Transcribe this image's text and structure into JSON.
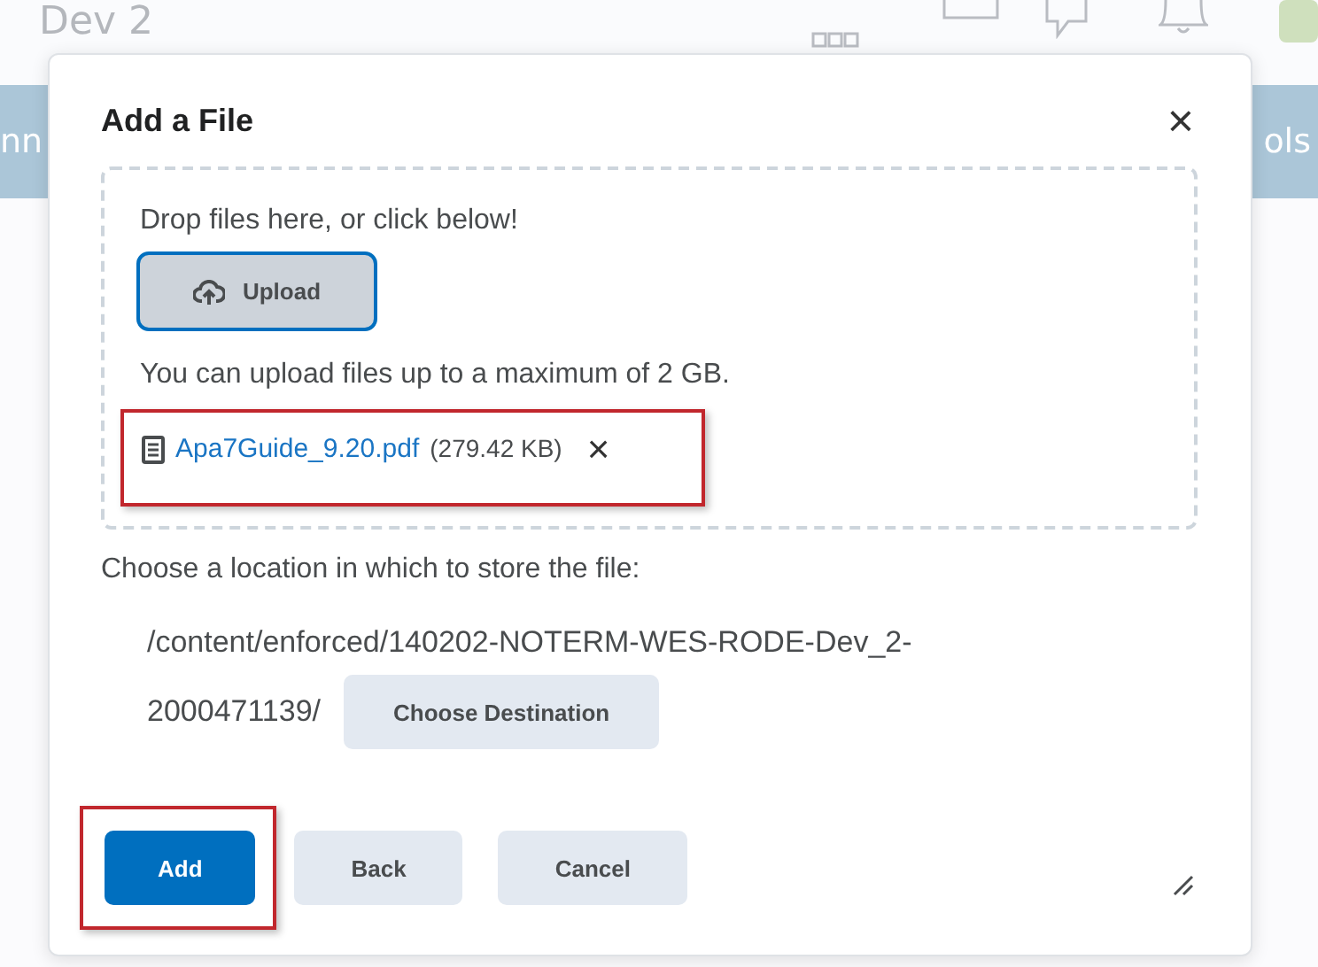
{
  "background": {
    "page_title": "Dev 2",
    "nav_left": "nn",
    "nav_right": "ols"
  },
  "dialog": {
    "title": "Add a File",
    "close": "×",
    "dropzone": {
      "prompt": "Drop files here, or click below!",
      "upload_button": "Upload",
      "limit_note": "You can upload files up to a maximum of 2 GB.",
      "files": [
        {
          "name": "Apa7Guide_9.20.pdf",
          "size": "(279.42 KB)",
          "remove": "×",
          "highlighted": true
        }
      ]
    },
    "location_label": "Choose a location in which to store the file:",
    "path_lines": [
      "/content/enforced/140202-NOTERM-WES-RODE-Dev_2-",
      "2000471139/"
    ],
    "choose_button": "Choose Destination",
    "buttons": [
      {
        "label": "Add",
        "kind": "primary",
        "highlighted": true
      },
      {
        "label": "Back",
        "kind": "secondary",
        "highlighted": false
      },
      {
        "label": "Cancel",
        "kind": "secondary",
        "highlighted": false
      }
    ]
  }
}
